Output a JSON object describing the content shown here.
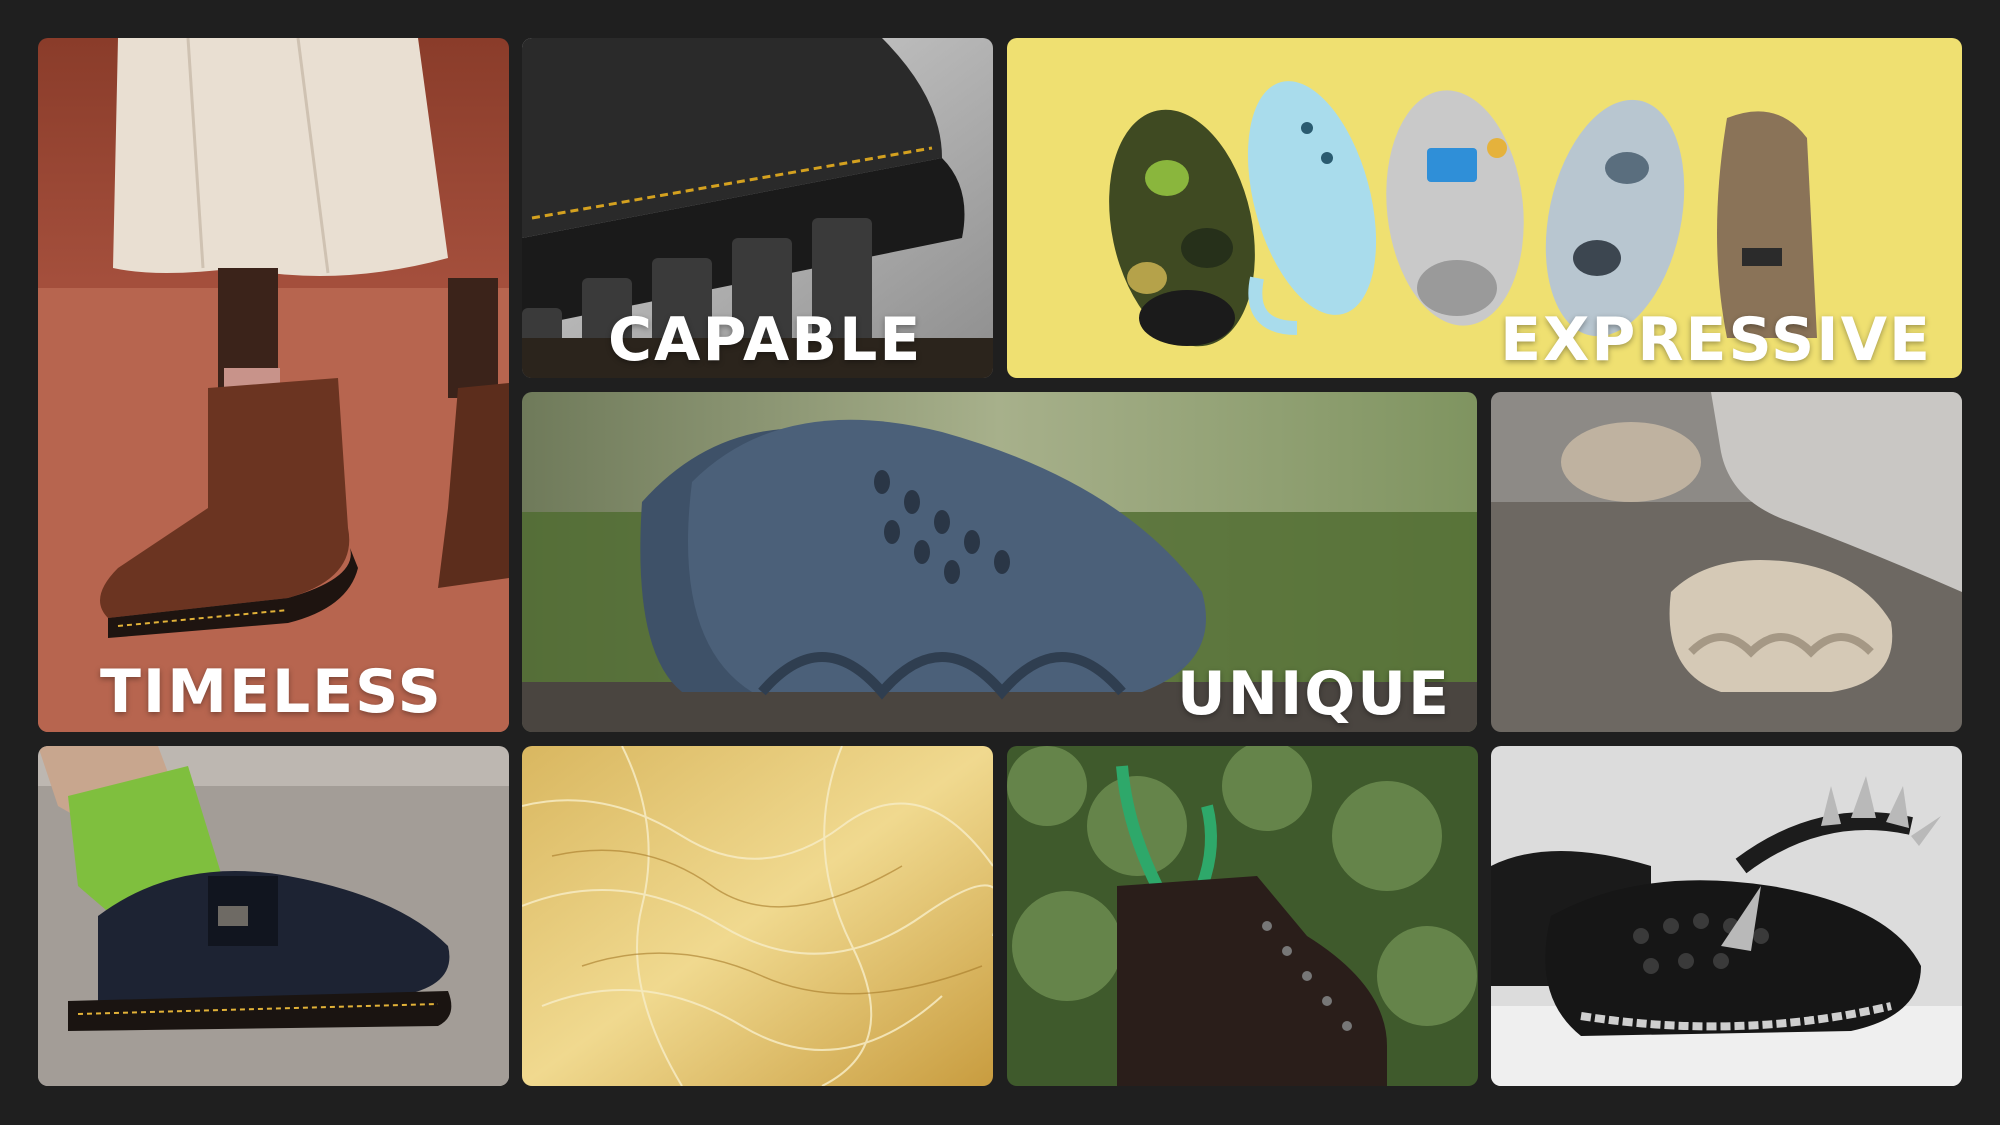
{
  "tiles": {
    "timeless": {
      "caption": "TIMELESS"
    },
    "capable": {
      "caption": "CAPABLE"
    },
    "expressive": {
      "caption": "EXPRESSIVE"
    },
    "unique": {
      "caption": "UNIQUE"
    }
  },
  "colors": {
    "background": "#1f1f1f",
    "caption": "#ffffff",
    "expressive_bg": "#efe071",
    "timeless_bg": "#b45c48"
  }
}
